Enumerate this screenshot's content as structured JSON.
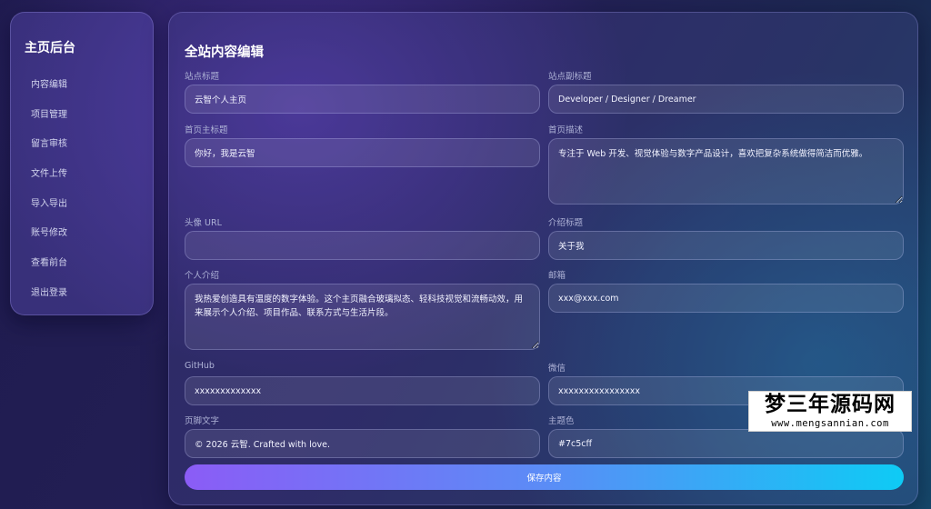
{
  "sidebar": {
    "title": "主页后台",
    "items": [
      {
        "label": "内容编辑"
      },
      {
        "label": "项目管理"
      },
      {
        "label": "留言审核"
      },
      {
        "label": "文件上传"
      },
      {
        "label": "导入导出"
      },
      {
        "label": "账号修改"
      },
      {
        "label": "查看前台"
      },
      {
        "label": "退出登录"
      }
    ]
  },
  "panel": {
    "title": "全站内容编辑",
    "fields": {
      "site_title": {
        "label": "站点标题",
        "value": "云智个人主页"
      },
      "site_subtitle": {
        "label": "站点副标题",
        "value": "Developer / Designer / Dreamer"
      },
      "home_title": {
        "label": "首页主标题",
        "value": "你好，我是云智"
      },
      "home_desc": {
        "label": "首页描述",
        "value": "专注于 Web 开发、视觉体验与数字产品设计，喜欢把复杂系统做得简洁而优雅。"
      },
      "avatar_url": {
        "label": "头像 URL",
        "value": ""
      },
      "intro_title": {
        "label": "介绍标题",
        "value": "关于我"
      },
      "intro": {
        "label": "个人介绍",
        "value": "我热爱创造具有温度的数字体验。这个主页融合玻璃拟态、轻科技视觉和流畅动效，用来展示个人介绍、项目作品、联系方式与生活片段。"
      },
      "email": {
        "label": "邮箱",
        "value": "xxx@xxx.com"
      },
      "github": {
        "label": "GitHub",
        "value": "xxxxxxxxxxxxx"
      },
      "wechat": {
        "label": "微信",
        "value": "xxxxxxxxxxxxxxxx"
      },
      "footer": {
        "label": "页脚文字",
        "value": "© 2026 云智. Crafted with love."
      },
      "theme_color": {
        "label": "主题色",
        "value": "#7c5cff"
      }
    },
    "save_label": "保存内容"
  },
  "watermark": {
    "title": "梦三年源码网",
    "url": "www.mengsannian.com"
  },
  "colors": {
    "accent_start": "#8b5cf6",
    "accent_end": "#0ecbf5"
  }
}
